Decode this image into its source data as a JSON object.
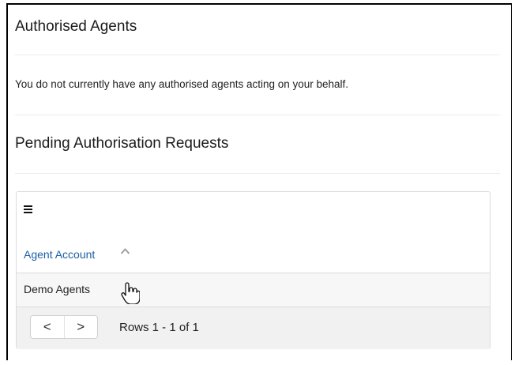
{
  "sections": {
    "authorised_title": "Authorised Agents",
    "authorised_message": "You do not currently have any authorised agents acting on your behalf.",
    "pending_title": "Pending Authorisation Requests"
  },
  "grid": {
    "menu_icon": "hamburger-menu-icon",
    "column_header": "Agent Account",
    "sort_icon": "chevron-up-icon",
    "rows": [
      "Demo Agents"
    ],
    "pager": {
      "prev": "<",
      "next": ">",
      "rows_text": "Rows 1 - 1 of 1"
    }
  },
  "colors": {
    "link": "#1a5fa6",
    "row_bg": "#f7f7f7",
    "pager_bg": "#f1f1f1"
  }
}
